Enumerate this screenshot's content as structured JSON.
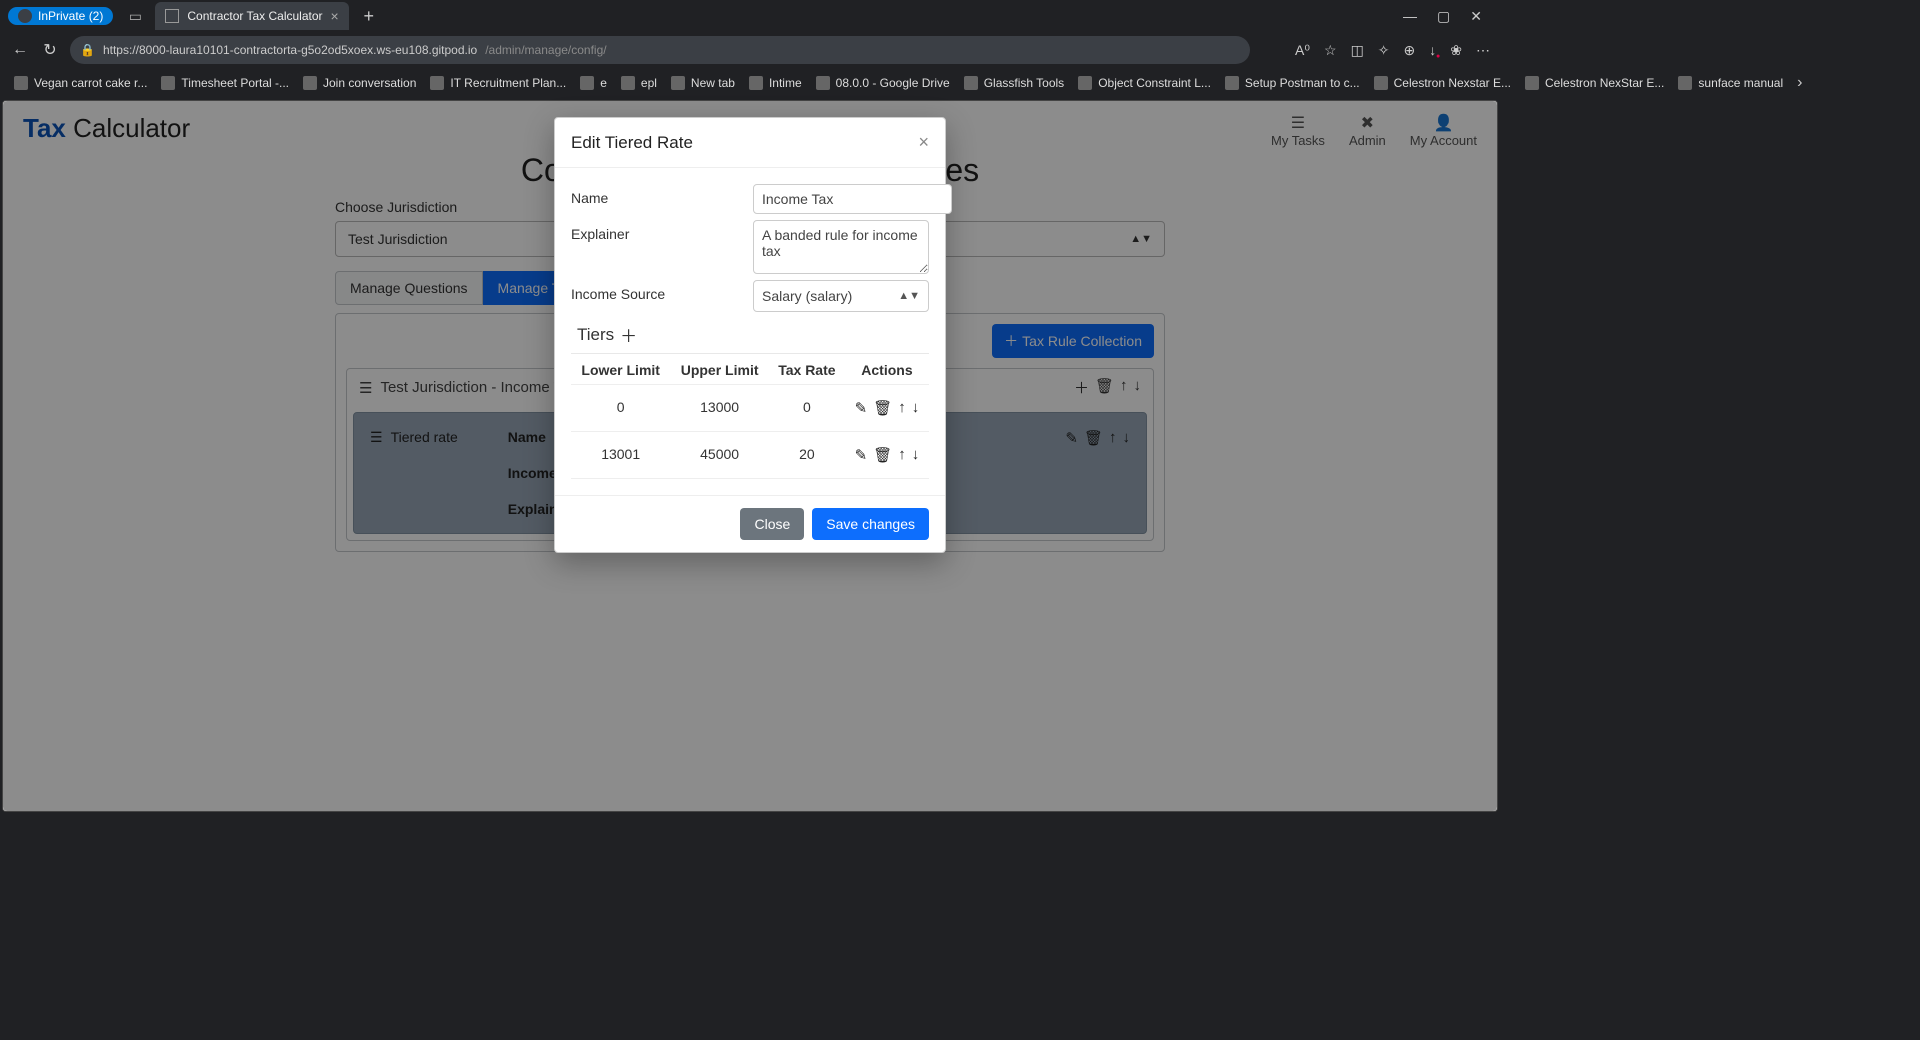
{
  "browser": {
    "inprivate_label": "InPrivate (2)",
    "tab_title": "Contractor Tax Calculator",
    "url_host": "https://8000-laura10101-contractorta-g5o2od5xoex.ws-eu108.gitpod.io",
    "url_path": "/admin/manage/config/",
    "bookmarks": [
      "Vegan carrot cake r...",
      "Timesheet Portal -...",
      "Join conversation",
      "IT Recruitment Plan...",
      "e",
      "epl",
      "New tab",
      "Intime",
      "08.0.0 - Google Drive",
      "Glassfish Tools",
      "Object Constraint L...",
      "Setup Postman to c...",
      "Celestron Nexstar E...",
      "Celestron NexStar E...",
      "sunface manual"
    ]
  },
  "header": {
    "brand_bold": "Tax",
    "brand_rest": " Calculator",
    "nav": {
      "tasks": "My Tasks",
      "admin": "Admin",
      "account": "My Account"
    }
  },
  "page": {
    "title": "Configure Jurisdiction Tax Rates",
    "choose_label": "Choose Jurisdiction",
    "jurisdiction_value": "Test Jurisdiction",
    "tabs": {
      "questions": "Manage Questions",
      "rates": "Manage Tax Rates"
    },
    "add_collection_btn": "Tax Rule Collection",
    "collection_title": "Test Jurisdiction - Income Tax",
    "tiered_rate_label": "Tiered rate",
    "field_labels": {
      "name": "Name",
      "income": "Income",
      "explainer": "Explainer"
    }
  },
  "modal": {
    "title": "Edit Tiered Rate",
    "labels": {
      "name": "Name",
      "explainer": "Explainer",
      "income_source": "Income Source"
    },
    "values": {
      "name": "Income Tax",
      "explainer": "A banded rule for income tax",
      "income_source": "Salary (salary)"
    },
    "tiers_heading": "Tiers",
    "columns": {
      "lower": "Lower Limit",
      "upper": "Upper Limit",
      "rate": "Tax Rate",
      "actions": "Actions"
    },
    "rows": [
      {
        "lower": "0",
        "upper": "13000",
        "rate": "0"
      },
      {
        "lower": "13001",
        "upper": "45000",
        "rate": "20"
      }
    ],
    "buttons": {
      "close": "Close",
      "save": "Save changes"
    }
  }
}
